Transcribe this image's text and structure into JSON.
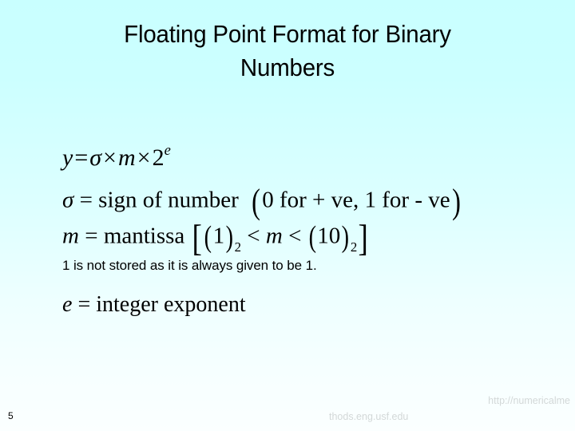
{
  "slide": {
    "background_top_color": "#ccffff",
    "background_bottom_color": "#fbffff",
    "text_color": "#000000"
  },
  "title": {
    "line1": "Floating Point Format for Binary",
    "line2": "Numbers",
    "full": "Floating Point Format for Binary Numbers"
  },
  "body": {
    "equation_1": {
      "lhs": "y",
      "eq": "=",
      "sigma": "σ",
      "times1": "×",
      "m": "m",
      "times2": "×",
      "base": "2",
      "exponent": "e",
      "plain": "y = σ × m × 2^e"
    },
    "equation_2": {
      "lhs": "σ",
      "eq": "=",
      "rhs": "sign of number",
      "paren_open": "(",
      "note": "0 for + ve, 1 for - ve",
      "paren_close": ")",
      "plain": "σ = sign of number (0 for + ve, 1 for - ve)"
    },
    "equation_3": {
      "lhs": "m",
      "eq": "=",
      "rhs": "mantissa",
      "bracket_open": "[",
      "lo_open": "(",
      "lo_value": "1",
      "lo_close": ")",
      "lo_sub": "2",
      "lt1": "<",
      "var": "m",
      "lt2": "<",
      "hi_open": "(",
      "hi_value": "10",
      "hi_close": ")",
      "hi_sub": "2",
      "bracket_close": "]",
      "plain": "m = mantissa [(1)2 < m < (10)2]"
    },
    "note_line": "1 is not stored as it is always given to be 1.",
    "equation_4": {
      "lhs": "e",
      "eq": "=",
      "rhs": "integer exponent",
      "plain": "e = integer exponent"
    }
  },
  "footer": {
    "page_number": "5",
    "url_line1": "http://numericalme",
    "url_line2": "thods.eng.usf.edu",
    "url_full": "http://numericalmethods.eng.usf.edu",
    "url_color": "#d3d8d8"
  }
}
